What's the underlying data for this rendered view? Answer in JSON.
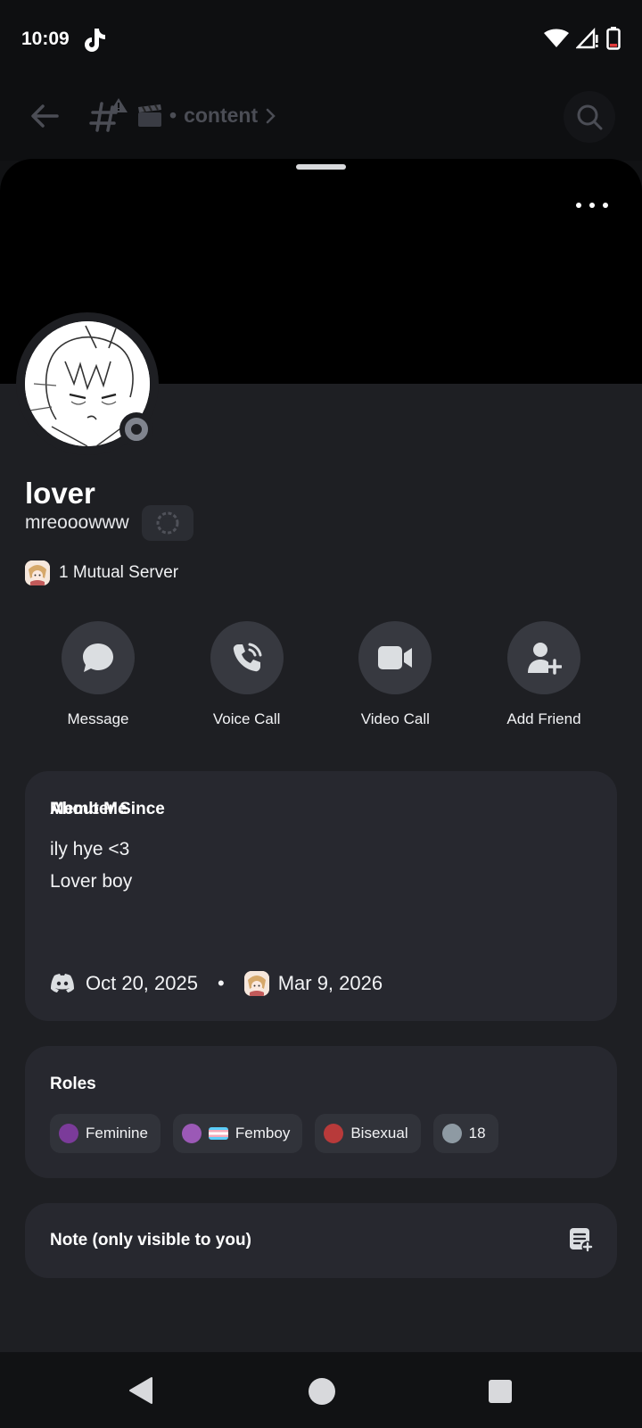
{
  "status_bar": {
    "time": "10:09"
  },
  "channel_header": {
    "channel_name": "content"
  },
  "profile": {
    "display_name": "lover",
    "username": "mreooowww",
    "mutual_servers": "1 Mutual Server",
    "status": "offline"
  },
  "actions": [
    {
      "label": "Message",
      "icon": "message-icon"
    },
    {
      "label": "Voice Call",
      "icon": "phone-icon"
    },
    {
      "label": "Video Call",
      "icon": "video-icon"
    },
    {
      "label": "Add Friend",
      "icon": "add-friend-icon"
    }
  ],
  "about": {
    "title": "About Me",
    "line1": "ily hye <3",
    "line2": "Lover boy"
  },
  "member_since": {
    "title": "Member Since",
    "discord_date": "Oct 20, 2025",
    "server_date": "Mar 9, 2026"
  },
  "roles": {
    "title": "Roles",
    "items": [
      {
        "label": "Feminine",
        "color": "#7b3b9a"
      },
      {
        "label": "Femboy",
        "color": "#9b59b6"
      },
      {
        "label": "Bisexual",
        "color": "#b83a3a"
      },
      {
        "label": "18",
        "color": "#8e9aa3"
      }
    ]
  },
  "note": {
    "title": "Note (only visible to you)"
  },
  "colors": {
    "background": "#111214",
    "sheet": "#1e1f23",
    "card": "#27282f",
    "action_button": "#373940"
  }
}
